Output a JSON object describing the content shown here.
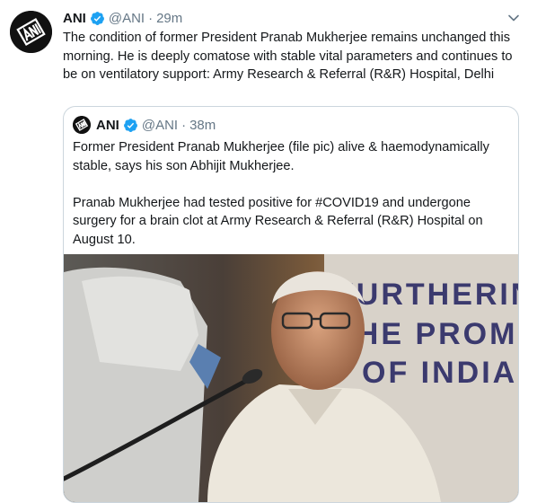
{
  "tweet": {
    "name": "ANI",
    "handle": "@ANI",
    "separator": "·",
    "time": "29m",
    "text": "The condition of former President Pranab Mukherjee remains unchanged this morning. He is deeply comatose with stable vital parameters and continues to be on ventilatory support: Army Research & Referral (R&R) Hospital, Delhi",
    "avatar_icon": "ani-logo-icon",
    "verified_icon": "verified-badge-icon",
    "menu_icon": "chevron-down-icon"
  },
  "quoted": {
    "name": "ANI",
    "handle": "@ANI",
    "separator": "·",
    "time": "38m",
    "paragraph1": "Former President Pranab Mukherjee (file pic) alive & haemodynamically stable, says his son Abhijit Mukherjee.",
    "paragraph2": "Pranab Mukherjee had tested positive for #COVID19 and undergone surgery for a brain clot at Army Research & Referral (R&R) Hospital on August 10.",
    "media": {
      "banner_line1": "FURTHERIN",
      "banner_line2": "THE PROMI",
      "banner_line3": "OF INDIA"
    }
  },
  "colors": {
    "text": "#14171a",
    "secondary": "#657786",
    "verified": "#1da1f2",
    "border": "#ccd6dd"
  }
}
